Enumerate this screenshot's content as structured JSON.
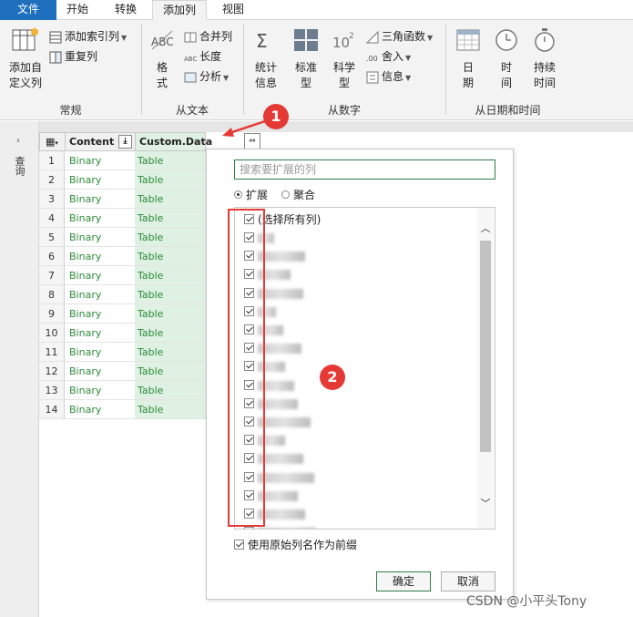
{
  "ribbon_tabs": [
    {
      "label": "文件"
    },
    {
      "label": "开始"
    },
    {
      "label": "转换"
    },
    {
      "label": "添加列"
    },
    {
      "label": "视图"
    }
  ],
  "groups": {
    "general": {
      "label": "常规",
      "custom_col": "添加自\n定义列",
      "index_col": "添加索引列",
      "dup_col": "重复列"
    },
    "from_text": {
      "label": "从文本",
      "format": "格\n式",
      "merge": "合并列",
      "length": "长度",
      "parse": "分析"
    },
    "from_number": {
      "label": "从数字",
      "stats": "统计\n信息",
      "standard": "标准\n型",
      "scientific": "科学\n型",
      "trig": "三角函数",
      "round": "舍入",
      "info": "信息"
    },
    "from_datetime": {
      "label": "从日期和时间",
      "date": "日\n期",
      "time": "时\n间",
      "duration": "持续\n时间"
    }
  },
  "left_panel": {
    "label": "查询"
  },
  "grid": {
    "columns": [
      "Content",
      "Custom.Data"
    ],
    "rows": [
      {
        "n": "1",
        "content": "Binary",
        "data": "Table"
      },
      {
        "n": "2",
        "content": "Binary",
        "data": "Table"
      },
      {
        "n": "3",
        "content": "Binary",
        "data": "Table"
      },
      {
        "n": "4",
        "content": "Binary",
        "data": "Table"
      },
      {
        "n": "5",
        "content": "Binary",
        "data": "Table"
      },
      {
        "n": "6",
        "content": "Binary",
        "data": "Table"
      },
      {
        "n": "7",
        "content": "Binary",
        "data": "Table"
      },
      {
        "n": "8",
        "content": "Binary",
        "data": "Table"
      },
      {
        "n": "9",
        "content": "Binary",
        "data": "Table"
      },
      {
        "n": "10",
        "content": "Binary",
        "data": "Table"
      },
      {
        "n": "11",
        "content": "Binary",
        "data": "Table"
      },
      {
        "n": "12",
        "content": "Binary",
        "data": "Table"
      },
      {
        "n": "13",
        "content": "Binary",
        "data": "Table"
      },
      {
        "n": "14",
        "content": "Binary",
        "data": "Table"
      }
    ]
  },
  "dialog": {
    "search_placeholder": "搜索要扩展的列",
    "expand": "扩展",
    "aggregate": "聚合",
    "select_all": "(选择所有列)",
    "prefix_label": "使用原始列名作为前缀",
    "ok": "确定",
    "cancel": "取消"
  },
  "badges": {
    "one": "1",
    "two": "2"
  },
  "watermark": "CSDN @小平头Tony"
}
